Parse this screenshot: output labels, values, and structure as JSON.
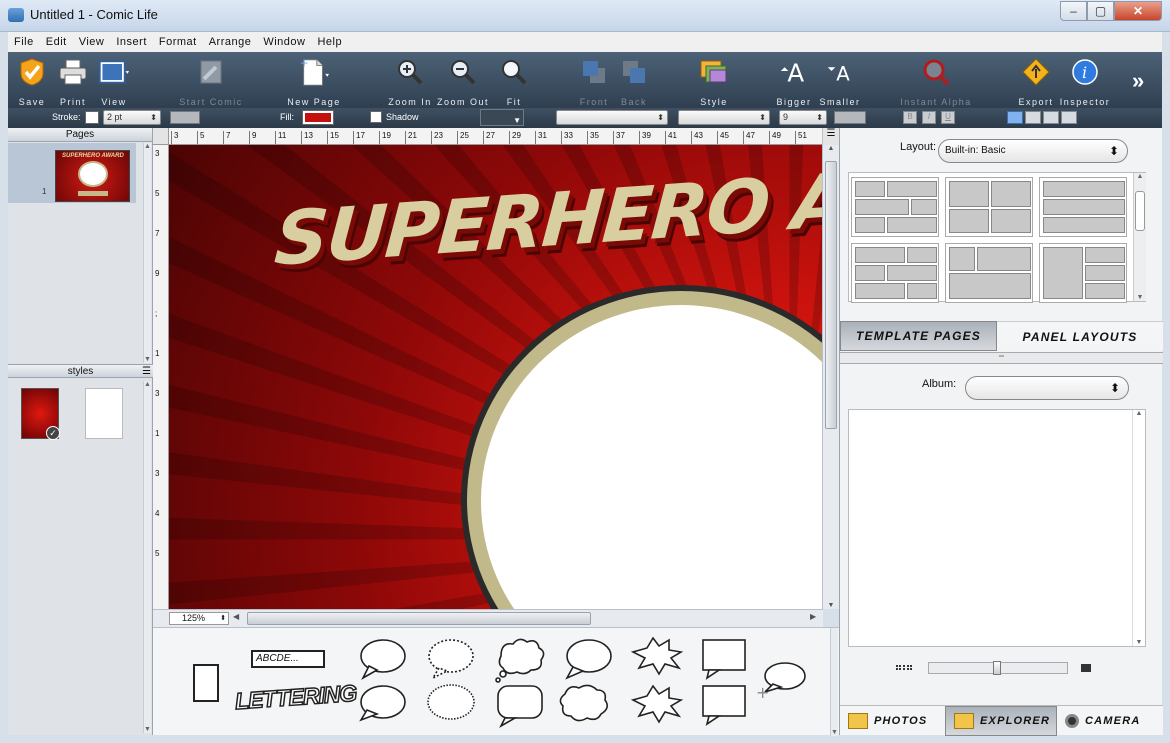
{
  "window": {
    "title": "Untitled 1 - Comic Life"
  },
  "menu": [
    "File",
    "Edit",
    "View",
    "Insert",
    "Format",
    "Arrange",
    "Window",
    "Help"
  ],
  "toolbar": {
    "save": "Save",
    "print": "Print",
    "view": "View",
    "start_comic": "Start Comic",
    "new_page": "New Page",
    "zoom_in": "Zoom In",
    "zoom_out": "Zoom Out",
    "fit": "Fit",
    "front": "Front",
    "back": "Back",
    "style": "Style",
    "bigger": "Bigger",
    "smaller": "Smaller",
    "instant_alpha": "Instant Alpha",
    "export": "Export",
    "inspector": "Inspector"
  },
  "formatbar": {
    "stroke_label": "Stroke:",
    "stroke_size": "2 pt",
    "fill_label": "Fill:",
    "shadow_label": "Shadow",
    "font_size": "9",
    "bold": "B",
    "italic": "I",
    "underline": "U",
    "fill_color": "#c4110e"
  },
  "left": {
    "pages_title": "Pages",
    "page_number": "1",
    "styles_title": "styles",
    "thumb_title": "SUPERHERO AWARD"
  },
  "canvas": {
    "headline": "SUPERHERO A",
    "ruler_h": [
      "3",
      "5",
      "7",
      "9",
      "11",
      "13",
      "15",
      "17",
      "19",
      "21",
      "23",
      "25",
      "27",
      "29",
      "31",
      "33",
      "35",
      "37",
      "39",
      "41",
      "43",
      "45",
      "47",
      "49",
      "51"
    ],
    "ruler_v": [
      "3",
      "5",
      "7",
      "9",
      ";",
      "1",
      "3",
      "1",
      "3",
      "4",
      "5"
    ],
    "zoom": "125%"
  },
  "balloons": {
    "caption_text": "ABCDE...",
    "lettering": "LETTERING"
  },
  "right": {
    "layout_label": "Layout:",
    "layout_value": "Built-in: Basic",
    "tab_template": "TEMPLATE PAGES",
    "tab_panel": "PANEL LAYOUTS",
    "album_label": "Album:",
    "album_value": "",
    "bottom_tabs": [
      "PHOTOS",
      "EXPLORER",
      "CAMERA"
    ]
  }
}
